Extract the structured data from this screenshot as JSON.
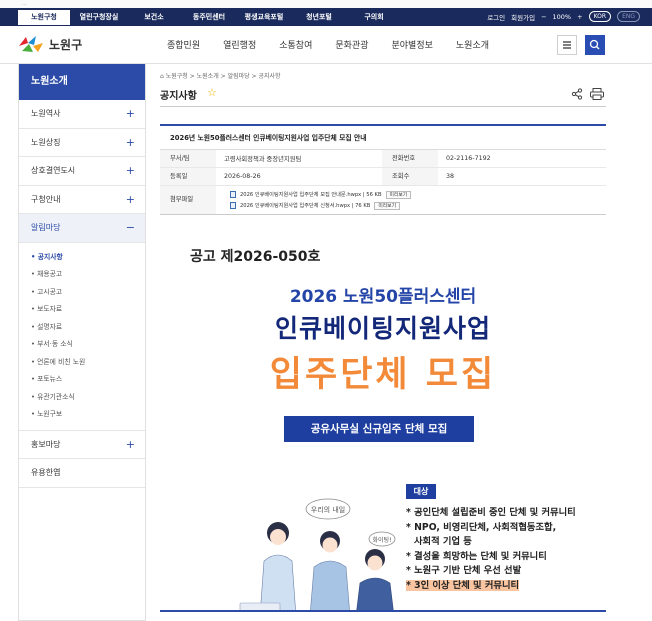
{
  "top": {
    "strip_text": "...",
    "tabs": [
      "노원구청",
      "열린구청장실",
      "보건소",
      "동주민센터",
      "평생교육포털",
      "청년포털",
      "구의회"
    ],
    "selected_tab": "노원구청",
    "login": "로그인",
    "join": "회원가입",
    "zoom": "100%",
    "zoom_minus": "−",
    "zoom_plus": "+",
    "lang_kor": "KOR",
    "lang_eng": "ENG"
  },
  "header": {
    "logo_text": "노원구",
    "gnb": [
      "종합민원",
      "열린행정",
      "소통참여",
      "문화관광",
      "분야별정보",
      "노원소개"
    ]
  },
  "sidebar": {
    "title": "노원소개",
    "items_top": [
      "노원역사",
      "노원상징",
      "상호결연도시",
      "구청안내"
    ],
    "active_item": "알림마당",
    "sub_items": [
      "공지사항",
      "채용공고",
      "고시공고",
      "보도자료",
      "설명자료",
      "부서·동 소식",
      "언론에 비친 노원",
      "포토뉴스",
      "유관기관소식",
      "노원구보"
    ],
    "items_bottom": [
      "홍보마당",
      "유용한엽"
    ]
  },
  "page": {
    "breadcrumb": "노원구청 > 노원소개 > 알림마당 > 공지사항",
    "title": "공지사항"
  },
  "post": {
    "subject": "2026년 노원50플러스센터 인큐베이팅지원사업 입주단체 모집 안내",
    "dept_label": "부서/팀",
    "dept": "고령사회정책과 중장년지원팀",
    "phone_label": "전화번호",
    "phone": "02-2116-7192",
    "date_label": "등록일",
    "date": "2026-08-26",
    "views_label": "조회수",
    "views": "38",
    "files_label": "첨부파일",
    "files": [
      {
        "name": "2026 인큐베이팅지원사업 입주단체 모집 안내문.hwpx",
        "size": "56 KB",
        "preview": "미리보기"
      },
      {
        "name": "2026 인큐베이팅지원사업 입주단체 신청서.hwpx",
        "size": "76 KB",
        "preview": "미리보기"
      }
    ]
  },
  "poster": {
    "notice_no": "공고 제2026-050호",
    "line1": "2026 노원50플러스센터",
    "line2": "인큐베이팅지원사업",
    "line3": "입주단체 모집",
    "bar": "공유사무실 신규입주 단체 모집",
    "bubble1": "우리의 내일",
    "bubble2": "화이팅!",
    "target_tag": "대상",
    "targets": [
      "* 공인단체 설립준비 중인 단체 및 커뮤니티",
      "* NPO, 비영리단체, 사회적협동조합,",
      "  사회적 기업 등",
      "* 결성을 희망하는 단체 및 커뮤니티",
      "* 노원구 기반 단체 우선 선발",
      "* 3인 이상 단체 및 커뮤니티"
    ],
    "colors": {
      "blue": "#1e3fa0",
      "navy": "#14287a",
      "orange": "#f38a3a"
    }
  }
}
